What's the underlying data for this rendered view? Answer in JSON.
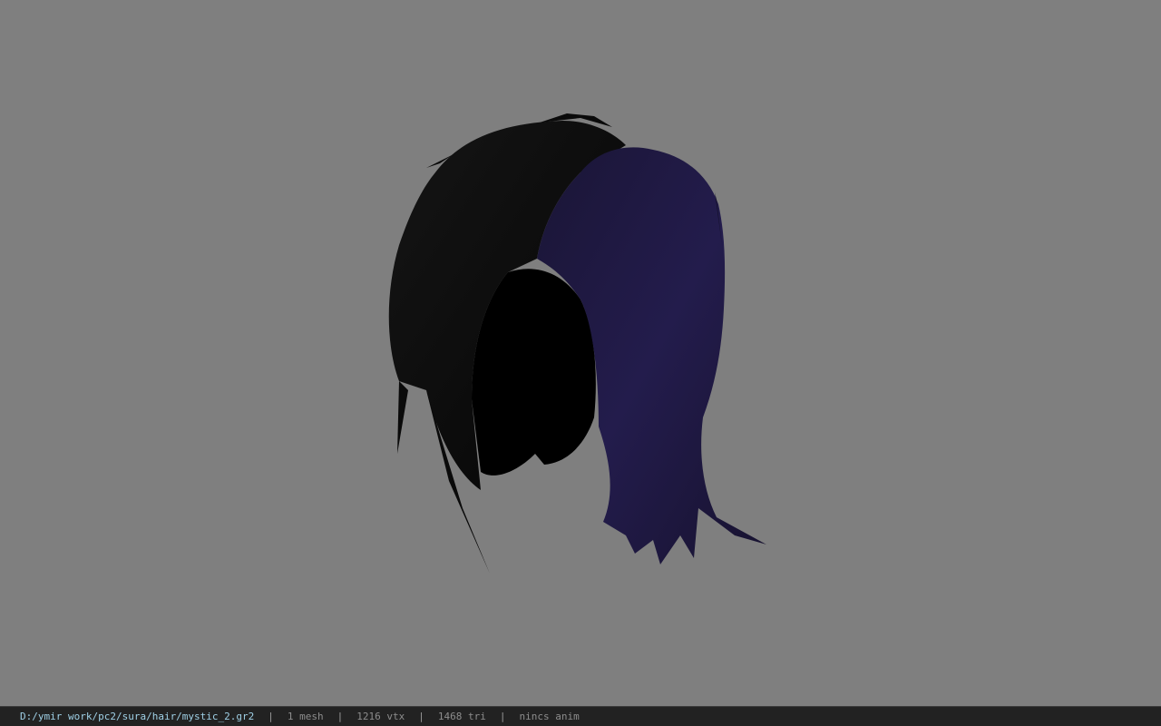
{
  "viewport": {
    "background": "#7f7f7f",
    "model": {
      "kind": "hair-mesh",
      "left_color": "#0b0b0b",
      "right_color": "#1e1840"
    }
  },
  "statusbar": {
    "file_path": "D:/ymir work/pc2/sura/hair/mystic_2.gr2",
    "separator": "|",
    "mesh_count": "1 mesh",
    "vertex_count": "1216 vtx",
    "triangle_count": "1468 tri",
    "anim_status": "nincs anim"
  }
}
